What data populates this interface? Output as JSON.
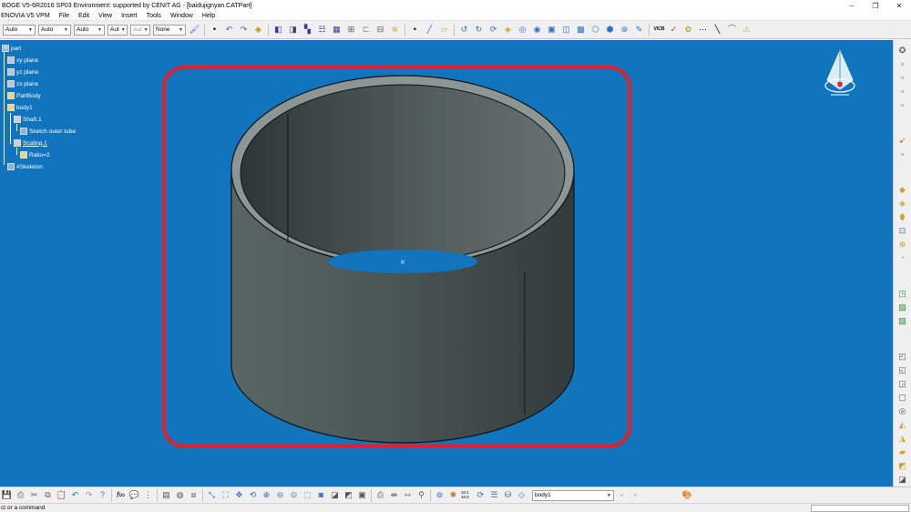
{
  "window": {
    "title": "BOGE V5-6R2016 SP03 Environment: supported by CENIT AG - [baidujignyan.CATPart]",
    "minimize": "–",
    "restore": "❐",
    "close": "✕"
  },
  "menu": [
    "ENOVIA V5 VPM",
    "File",
    "Edit",
    "View",
    "Insert",
    "Tools",
    "Window",
    "Help"
  ],
  "toolbar": {
    "combos": [
      {
        "value": "Auto",
        "dim": false
      },
      {
        "value": "Auto",
        "dim": false
      },
      {
        "value": "Auto",
        "dim": false
      },
      {
        "value": "Aut",
        "dim": false
      },
      {
        "value": "Aut",
        "dim": true
      },
      {
        "value": "None",
        "dim": false
      }
    ],
    "icons": [
      "paint-brush-icon",
      "point-icon",
      "undo-curve-icon",
      "rotate-icon",
      "eraser-icon",
      "pin-icon",
      "pin-alt-icon",
      "hand-icon",
      "select-filter-icon",
      "grid-icon",
      "snap-icon",
      "frame-icon",
      "measure-icon",
      "layers-icon",
      "point-icon",
      "line-icon",
      "plane-icon",
      "spline-icon",
      "circle-icon",
      "sweep-icon",
      "extrude-icon",
      "split-icon",
      "join-icon",
      "fill-icon",
      "blend-icon",
      "offset-icon",
      "transform-icon",
      "pattern-icon",
      "sketch-icon",
      "text-icon",
      "vicb-icon",
      "check-icon",
      "paint-icon",
      "dotted-line-icon",
      "slash-icon",
      "arc-icon",
      "triangle-warning-icon"
    ]
  },
  "tree": {
    "nodes": [
      {
        "label": "part",
        "icon": "part-icon",
        "underline": false
      },
      {
        "label": "xy plane",
        "icon": "plane-icon",
        "underline": false
      },
      {
        "label": "yz plane",
        "icon": "plane-icon",
        "underline": false
      },
      {
        "label": "zx plane",
        "icon": "plane-icon",
        "underline": false
      },
      {
        "label": "PartBody",
        "icon": "body-icon",
        "underline": false
      },
      {
        "label": "body1",
        "icon": "body-icon",
        "underline": false
      },
      {
        "label": "Shaft.1",
        "icon": "shaft-icon",
        "underline": false
      },
      {
        "label": "Sketch outer tube",
        "icon": "sketch-icon",
        "underline": false
      },
      {
        "label": "Scaling.1",
        "icon": "scaling-icon",
        "underline": true
      },
      {
        "label": "Ratio=2",
        "icon": "parameter-icon",
        "underline": false
      },
      {
        "label": "#Skeleton",
        "icon": "skeleton-icon",
        "underline": false
      }
    ]
  },
  "viewport": {
    "background": "#1075bd",
    "highlight_color": "#e0202a",
    "cylinder_color": "#4f5b58",
    "axis_mark": "×"
  },
  "bottom": {
    "current_body": "body1",
    "zoom_label": "10:1 10.0"
  },
  "status": {
    "prompt": "ct or a command"
  },
  "right_toolbar_icons": [
    "compass-icon",
    "sketch-icon",
    "cube-icon",
    "grid-icon",
    "plane-icon",
    "pointer-icon",
    "move-icon",
    "pad-icon",
    "pocket-icon",
    "cylinder-icon",
    "hole-icon",
    "rib-icon",
    "circle-icon",
    "dress-up-icon",
    "shell-icon",
    "face-icon",
    "mirror-icon",
    "pattern-icon",
    "scale-icon",
    "fillet-icon",
    "chamfer-icon",
    "draft-icon",
    "boolean-icon",
    "thick-icon",
    "split-icon",
    "thread-icon",
    "analysis-icon",
    "material-icon"
  ]
}
